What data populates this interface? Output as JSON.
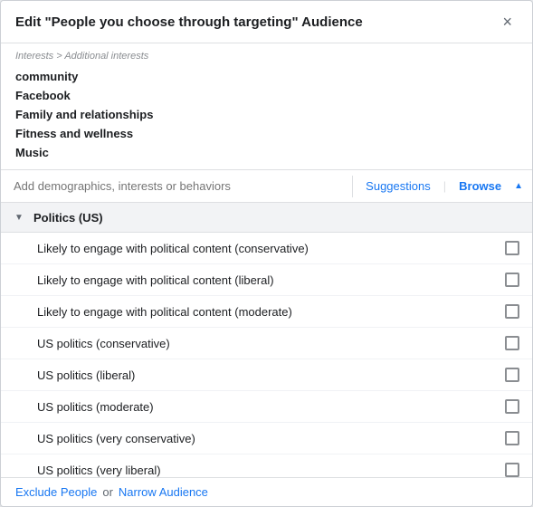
{
  "modal": {
    "title": "Edit \"People you choose through targeting\" Audience",
    "close_label": "×"
  },
  "interests": {
    "header": "Interests > Additional interests",
    "items": [
      {
        "label": "community"
      },
      {
        "label": "Facebook"
      },
      {
        "label": "Family and relationships"
      },
      {
        "label": "Fitness and wellness"
      },
      {
        "label": "Music"
      }
    ]
  },
  "search": {
    "placeholder": "Add demographics, interests or behaviors",
    "suggestions_label": "Suggestions",
    "browse_label": "Browse"
  },
  "category": {
    "label": "Politics (US)"
  },
  "options": [
    {
      "label": "Likely to engage with political content (conservative)"
    },
    {
      "label": "Likely to engage with political content (liberal)"
    },
    {
      "label": "Likely to engage with political content (moderate)"
    },
    {
      "label": "US politics (conservative)"
    },
    {
      "label": "US politics (liberal)"
    },
    {
      "label": "US politics (moderate)"
    },
    {
      "label": "US politics (very conservative)"
    },
    {
      "label": "US politics (very liberal)"
    }
  ],
  "footer": {
    "exclude_label": "Exclude People",
    "or_label": "or",
    "narrow_label": "Narrow Audience"
  }
}
